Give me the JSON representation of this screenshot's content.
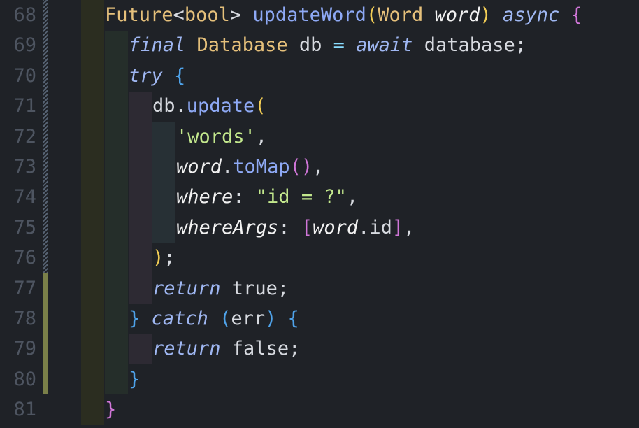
{
  "line_numbers": [
    "68",
    "69",
    "70",
    "71",
    "72",
    "73",
    "74",
    "75",
    "76",
    "77",
    "78",
    "79",
    "80",
    "81"
  ],
  "code": {
    "l68": {
      "t1": "Future",
      "t2": "<",
      "t3": "bool",
      "t4": "> ",
      "t5": "updateWord",
      "t6": "(",
      "t7": "Word",
      "t8": " ",
      "t9": "word",
      "t10": ") ",
      "t11": "async",
      "t12": " {"
    },
    "l69": {
      "t1": "final",
      "t2": " ",
      "t3": "Database",
      "t4": " db ",
      "t5": "=",
      "t6": " ",
      "t7": "await",
      "t8": " database;"
    },
    "l70": {
      "t1": "try",
      "t2": " {"
    },
    "l71": {
      "t1": "db",
      "t2": ".",
      "t3": "update",
      "t4": "("
    },
    "l72": {
      "t1": "'words'",
      "t2": ","
    },
    "l73": {
      "t1": "word",
      "t2": ".",
      "t3": "toMap",
      "t4": "()",
      "t5": ","
    },
    "l74": {
      "t1": "where",
      "t2": ": ",
      "t3": "\"id = ?\"",
      "t4": ","
    },
    "l75": {
      "t1": "whereArgs",
      "t2": ": ",
      "t3": "[",
      "t4": "word",
      "t5": ".",
      "t6": "id",
      "t7": "]",
      "t8": ","
    },
    "l76": {
      "t1": ")",
      "t2": ";"
    },
    "l77": {
      "t1": "return",
      "t2": " true;"
    },
    "l78": {
      "t1": "}",
      "t2": " ",
      "t3": "catch",
      "t4": " ",
      "t5": "(",
      "t6": "err",
      "t7": ")",
      "t8": " {"
    },
    "l79": {
      "t1": "return",
      "t2": " false;"
    },
    "l80": {
      "t1": "}"
    },
    "l81": {
      "t1": "}"
    }
  }
}
